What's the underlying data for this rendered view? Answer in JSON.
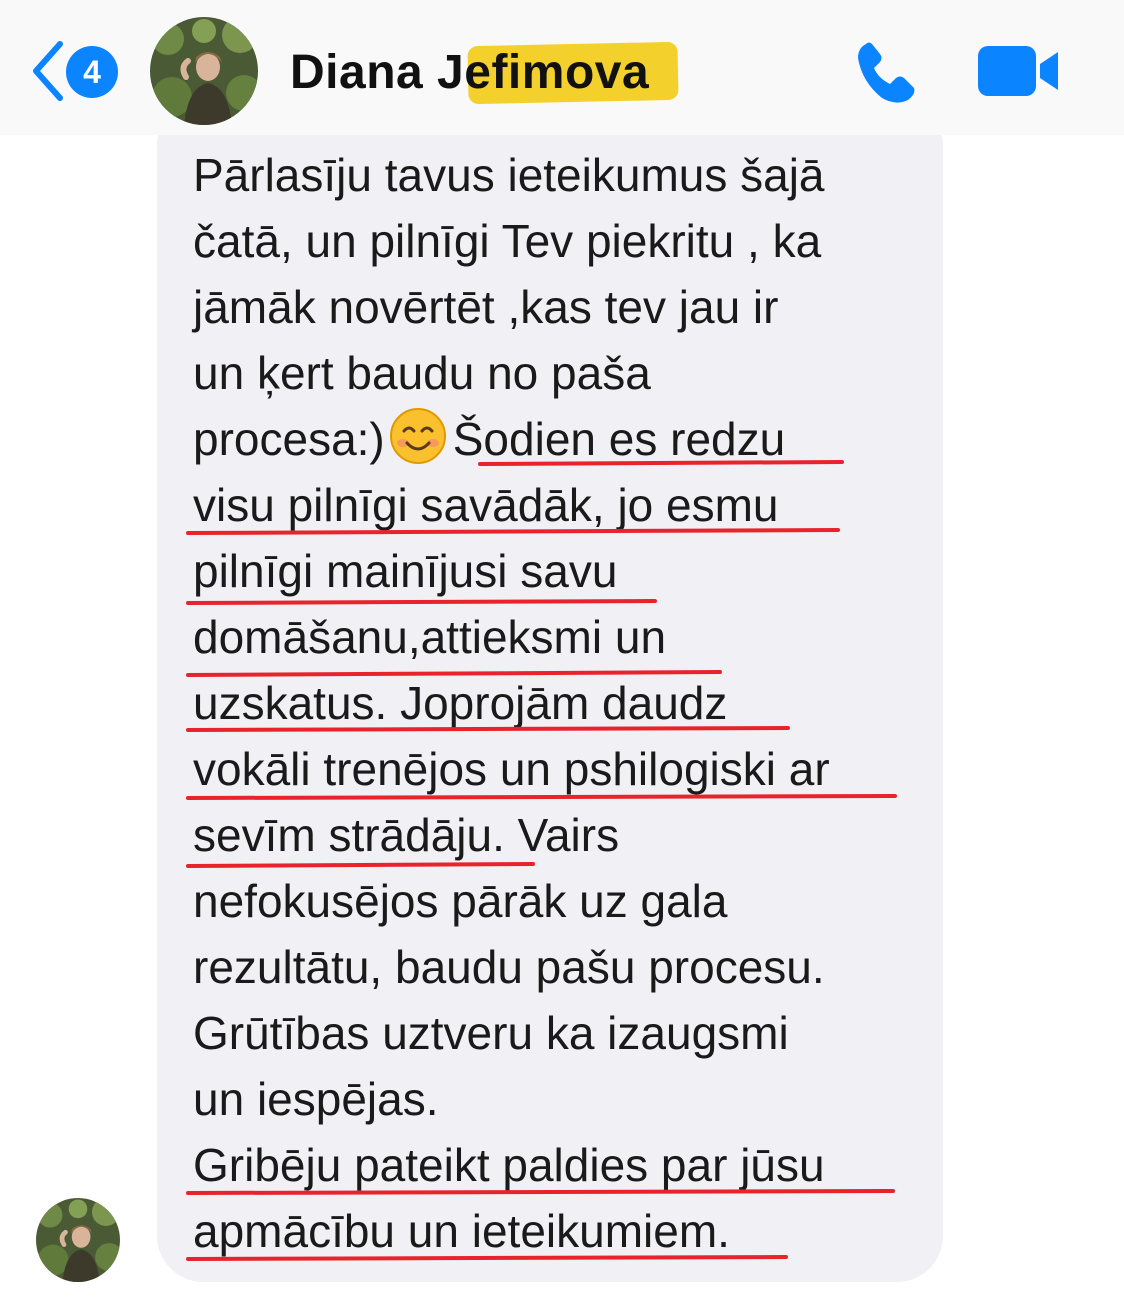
{
  "header": {
    "back_icon": "chevron-left-icon",
    "unread_count": "4",
    "contact_name": "Diana Jefimova",
    "avatar_icon": "contact-photo",
    "call_icon": "phone-icon",
    "video_icon": "video-camera-icon",
    "accent_color": "#0a84ff",
    "name_redaction_color": "#f3cd21"
  },
  "message": {
    "lines": [
      "Pārlasīju tavus ieteikumus šajā",
      "čatā, un pilnīgi Tev piekritu , ka",
      "jāmāk novērtēt ,kas  tev jau ir",
      "un ķert baudu no paša",
      "procesa:)",
      "Šodien es redzu",
      "visu pilnīgi savādāk, jo esmu",
      "pilnīgi mainījusi savu",
      "domāšanu,attieksmi un",
      "uzskatus. Joprojām daudz",
      "vokāli trenējos un pshilogiski ar",
      "sevīm strādāju.",
      " Vairs",
      "nefokusējos pārāk uz gala",
      "rezultātu, baudu pašu procesu.",
      "Grūtības uztveru ka izaugsmi",
      "un iespējas.",
      "Gribēju pateikt paldies par jūsu",
      "apmācību un ieteikumiem."
    ],
    "emoji": "smiling-face-emoji",
    "bubble_color": "#f0f0f5",
    "underline_color": "#e8232c"
  },
  "footer": {
    "avatar_icon": "contact-photo"
  }
}
